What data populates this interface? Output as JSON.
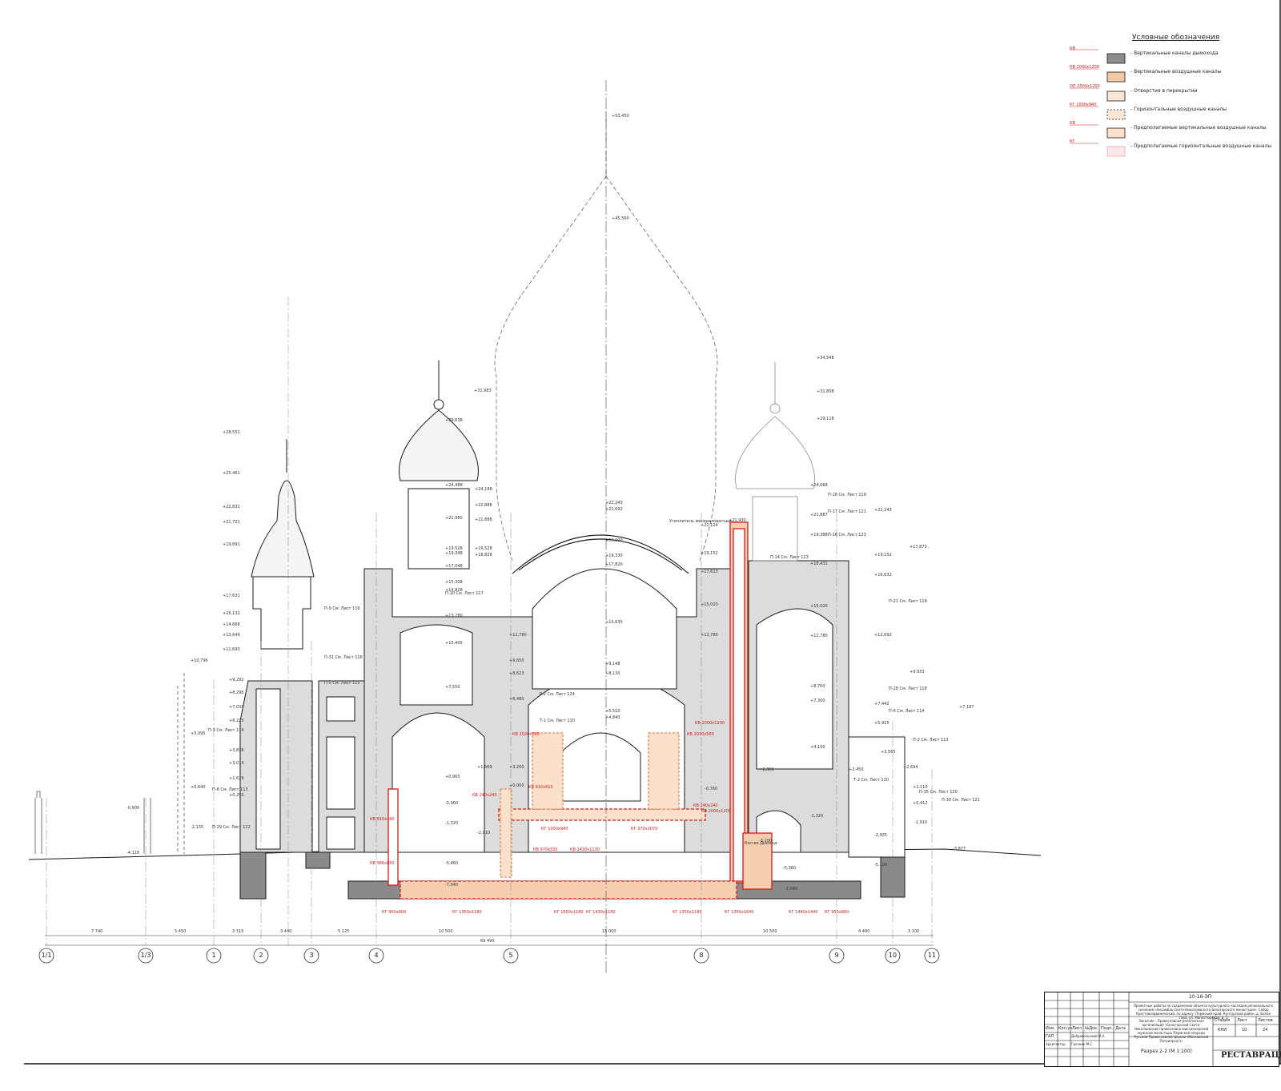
{
  "legend": {
    "title": "Условные обозначения",
    "items": [
      {
        "code": "КВ",
        "label": "- Вертикальные каналы дымохода",
        "fill": "#8c8c8c"
      },
      {
        "code": "КВ 2000x1200",
        "label": "- Вертикальные воздушные каналы",
        "fill": "#f3c9a5"
      },
      {
        "code": "ОП 2000x1200",
        "label": "- Отверстия в перекрытии",
        "fill": "#fbe6d6"
      },
      {
        "code": "КГ 1000x940",
        "label": "- Горизонтальные воздушные каналы",
        "fill": "#fbe6d6"
      },
      {
        "code": "КВ",
        "label": "- Предполагаемые вертикальные воздушные каналы",
        "fill": "#fbe0cc"
      },
      {
        "code": "КГ",
        "label": "- Предполагаемые горизонтальные воздушные каналы",
        "fill": "#fbe6ea"
      }
    ]
  },
  "elevations_left": [
    "+28,551",
    "+25,461",
    "+22,831",
    "+21,721",
    "+19,891",
    "+17,631",
    "+16,132",
    "+14,668",
    "+13,649",
    "+11,693",
    "+10,796",
    "+9,292",
    "+8,296",
    "+7,034",
    "+6,225",
    "+5,095",
    "+3,838",
    "+3,014",
    "+1,629",
    "+0,640",
    "+0,250",
    "-0,900",
    "-2,135",
    "-4,116"
  ],
  "elevations_center": [
    "+53,450",
    "+45,560",
    "+31,983",
    "+29,638",
    "+24,488",
    "+24,188",
    "+22,888",
    "+21,960",
    "+21,888",
    "+19,528",
    "+19,348",
    "+19,528",
    "+18,828",
    "+17,048",
    "+15,308",
    "+14,828",
    "+13,280",
    "+12,780",
    "+10,400",
    "+9,650",
    "+8,623",
    "+7,550",
    "+6,480",
    "+5,510",
    "+4,840",
    "+3,200",
    "+1,569",
    "+0,965",
    "+0,000",
    "-0,960",
    "-1,320",
    "-2,910",
    "-5,460",
    "-7,040",
    "+22,243",
    "+21,692",
    "+19,900",
    "+19,330",
    "+17,820",
    "+13,635",
    "+9,148",
    "+8,130",
    "+21,930",
    "+21,124",
    "+19,152",
    "+17,613",
    "+15,020",
    "+12,780"
  ],
  "elevations_right": [
    "+34,548",
    "+31,808",
    "+29,118",
    "+24,068",
    "+22,243",
    "+21,887",
    "+19,388",
    "+18,431",
    "+19,152",
    "+17,873",
    "+16,632",
    "+15,020",
    "+12,780",
    "+12,692",
    "+9,933",
    "+8,700",
    "+7,300",
    "+7,442",
    "+7,187",
    "+5,915",
    "+4,100",
    "+3,565",
    "+2,694",
    "+2,450",
    "+2,300",
    "+1,110",
    "+0,412",
    "-0,760",
    "-1,320",
    "-1,910",
    "-2,935",
    "-3,200",
    "-3,877",
    "-5,100",
    "-5,360",
    "-7,040"
  ],
  "callouts": [
    {
      "code": "П-18",
      "ref": "См. Лист 119"
    },
    {
      "code": "П-17",
      "ref": "См. Лист 121"
    },
    {
      "code": "П-16",
      "ref": "См. Лист 123"
    },
    {
      "code": "П-14",
      "ref": "См. Лист 123"
    },
    {
      "code": "П-21",
      "ref": "См. Лист 118"
    },
    {
      "code": "П-28",
      "ref": "См. Лист 118"
    },
    {
      "code": "П-6",
      "ref": "См. Лист 114"
    },
    {
      "code": "П-2",
      "ref": "См. Лист 113"
    },
    {
      "code": "П-35",
      "ref": "См. Лист 120"
    },
    {
      "code": "П-30",
      "ref": "См. Лист 121"
    },
    {
      "code": "Т-2",
      "ref": "См. Лист 110"
    },
    {
      "code": "П-9",
      "ref": "См. Лист 116"
    },
    {
      "code": "П-31",
      "ref": "См. Лист 116"
    },
    {
      "code": "П-5",
      "ref": "См. Лист 115"
    },
    {
      "code": "П-3",
      "ref": "См. Лист 114"
    },
    {
      "code": "П-8",
      "ref": "См. Лист 113"
    },
    {
      "code": "П-29",
      "ref": "См. Лист 112"
    },
    {
      "code": "П-10",
      "ref": "См. Лист 117"
    },
    {
      "code": "Р-2",
      "ref": "См. Лист 124"
    },
    {
      "code": "Т-1",
      "ref": "См. Лист 110"
    }
  ],
  "ducts": [
    {
      "code": "КВ",
      "size": "2020x560"
    },
    {
      "code": "КВ",
      "size": "2020x560"
    },
    {
      "code": "КВ",
      "size": "2000x1200"
    },
    {
      "code": "КВ",
      "size": "910x610"
    },
    {
      "code": "КВ",
      "size": "240x240"
    },
    {
      "code": "КВ",
      "size": "240x240"
    },
    {
      "code": "КВ",
      "size": "2000x1200"
    },
    {
      "code": "КВ",
      "size": "910x480"
    },
    {
      "code": "КВ",
      "size": "980x850"
    },
    {
      "code": "КГ",
      "size": "1000x940"
    },
    {
      "code": "КВ",
      "size": "970x530"
    },
    {
      "code": "КВ",
      "size": "1430x1130"
    },
    {
      "code": "КГ",
      "size": "370x1070"
    },
    {
      "code": "КГ",
      "size": "950x800"
    },
    {
      "code": "КГ",
      "size": "1350x1180"
    },
    {
      "code": "КГ",
      "size": "1650x1180"
    },
    {
      "code": "КГ",
      "size": "1430x1180"
    },
    {
      "code": "КГ",
      "size": "1350x1180"
    },
    {
      "code": "КГ",
      "size": "1350x1640"
    },
    {
      "code": "КГ",
      "size": "1440x1440"
    },
    {
      "code": "КГ",
      "size": "950x880"
    }
  ],
  "room_labels": {
    "chimney_note": "Кол-во Дымход",
    "ventilation_note": "Утеплитель минераловатный"
  },
  "dimensions": {
    "segments": [
      "7 740",
      "5 450",
      "3 315",
      "3 440",
      "5 125",
      "10 500",
      "15 000",
      "10 500",
      "4 400",
      "3 100"
    ],
    "total": "69 490"
  },
  "axes": [
    "1/1",
    "1/3",
    "1",
    "2",
    "3",
    "4",
    "5",
    "8",
    "9",
    "10",
    "11"
  ],
  "stamp": {
    "code": "10-16-ЭП",
    "project": "Проектные работы по сохранению объекта культурного наследия регионального значения «Ансамбль Свято-Николаевского Белогорского монастыря»: Собор Крестовоздвиженский, по адресу: Пермский край, Кунгурский район, д. Белая Гора, ул. Монастырская, д. 1",
    "customer": "Заказчик - Православная религиозная организация «Белогорский Свято-Николаевский православно-миссионерский мужской монастырь Пермской епархии Русской Православной Церкви (Московский Патриархат)»",
    "sheet_title": "Разрез 2-2 (М 1:100)",
    "stage_hdr": "Стадия",
    "stage": "КНИ",
    "sheet_hdr": "Лист",
    "sheet_no": "10",
    "sheets_hdr": "Листов",
    "sheets_total": "24",
    "cols": [
      "Изм.",
      "Кол.уч",
      "Лист",
      "№Док.",
      "Подп.",
      "Дата"
    ],
    "role1": "ГАП",
    "person1": "Добровольский М.А.",
    "role2": "Архитектор",
    "person2": "Гречкин М.С.",
    "org": "РЕСТАВРАЦИЯ"
  },
  "colors": {
    "line": "#1a1a1a",
    "wall": "#dcdcdc",
    "ground": "#8a8a8a",
    "duct_red": "#d21c1c",
    "duct_fill": "#f6cfb0"
  }
}
